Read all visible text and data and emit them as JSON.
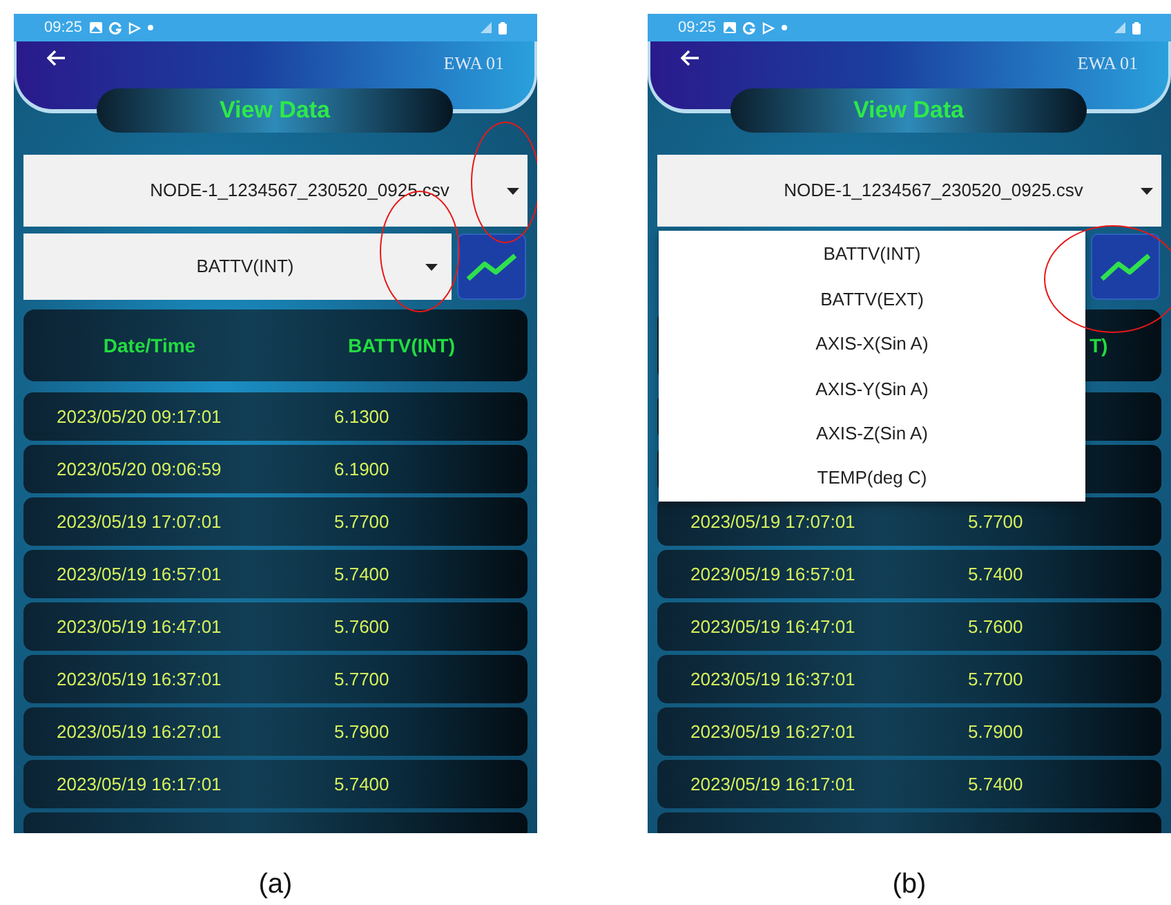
{
  "panels": [
    {
      "caption": "(a)",
      "status_time": "09:25",
      "device": "EWA 01",
      "title": "View Data",
      "file_select": "NODE-1_1234567_230520_0925.csv",
      "channel_select": "BATTV(INT)",
      "header": {
        "col1": "Date/Time",
        "col2": "BATTV(INT)"
      },
      "rows": [
        {
          "date": "2023/05/20 09:17:01",
          "value": "6.1300"
        },
        {
          "date": "2023/05/20 09:06:59",
          "value": "6.1900"
        },
        {
          "date": "2023/05/19 17:07:01",
          "value": "5.7700"
        },
        {
          "date": "2023/05/19 16:57:01",
          "value": "5.7400"
        },
        {
          "date": "2023/05/19 16:47:01",
          "value": "5.7600"
        },
        {
          "date": "2023/05/19 16:37:01",
          "value": "5.7700"
        },
        {
          "date": "2023/05/19 16:27:01",
          "value": "5.7900"
        },
        {
          "date": "2023/05/19 16:17:01",
          "value": "5.7400"
        }
      ]
    },
    {
      "caption": "(b)",
      "status_time": "09:25",
      "device": "EWA 01",
      "title": "View Data",
      "file_select": "NODE-1_1234567_230520_0925.csv",
      "header": {
        "col2": "T)"
      },
      "menu": [
        "BATTV(INT)",
        "BATTV(EXT)",
        "AXIS-X(Sin A)",
        "AXIS-Y(Sin A)",
        "AXIS-Z(Sin A)",
        "TEMP(deg C)"
      ],
      "rows": [
        {
          "date": "2023/05/19 17:07:01",
          "value": "5.7700"
        },
        {
          "date": "2023/05/19 16:57:01",
          "value": "5.7400"
        },
        {
          "date": "2023/05/19 16:47:01",
          "value": "5.7600"
        },
        {
          "date": "2023/05/19 16:37:01",
          "value": "5.7700"
        },
        {
          "date": "2023/05/19 16:27:01",
          "value": "5.7900"
        },
        {
          "date": "2023/05/19 16:17:01",
          "value": "5.7400"
        }
      ]
    }
  ]
}
